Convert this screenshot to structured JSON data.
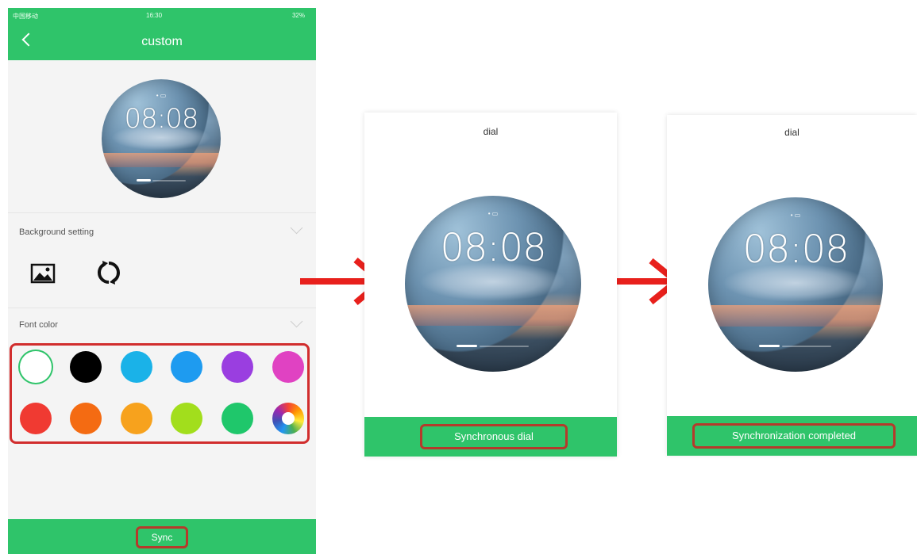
{
  "phone": {
    "status": {
      "carrier": "中国移动",
      "time": "16:30",
      "battery": "32%"
    },
    "title": "custom",
    "watch": {
      "time": "08:08"
    },
    "background_setting": {
      "label": "Background setting",
      "image_icon": "image-icon",
      "rotate_icon": "rotate-icon"
    },
    "font_color": {
      "label": "Font color",
      "swatches": [
        {
          "name": "white",
          "color": "#ffffff",
          "selected": true
        },
        {
          "name": "black",
          "color": "#000000"
        },
        {
          "name": "light-blue",
          "color": "#1ab2e8"
        },
        {
          "name": "blue",
          "color": "#1e9bf0"
        },
        {
          "name": "purple",
          "color": "#9a3ee0"
        },
        {
          "name": "magenta",
          "color": "#e042c2"
        },
        {
          "name": "red",
          "color": "#f03a32"
        },
        {
          "name": "dark-orange",
          "color": "#f46b12"
        },
        {
          "name": "orange",
          "color": "#f7a21d"
        },
        {
          "name": "lime",
          "color": "#a2de1c"
        },
        {
          "name": "green",
          "color": "#1fc76b"
        },
        {
          "name": "color-wheel",
          "color": "wheel"
        }
      ]
    },
    "sync_label": "Sync"
  },
  "screen2": {
    "title": "dial",
    "watch": {
      "time": "08:08"
    },
    "button_label": "Synchronous dial"
  },
  "screen3": {
    "title": "dial",
    "watch": {
      "time": "08:08"
    },
    "button_label": "Synchronization completed"
  },
  "colors": {
    "brand_green": "#2fc46a",
    "highlight_red": "#d12d2d",
    "arrow_red": "#e8201c"
  }
}
